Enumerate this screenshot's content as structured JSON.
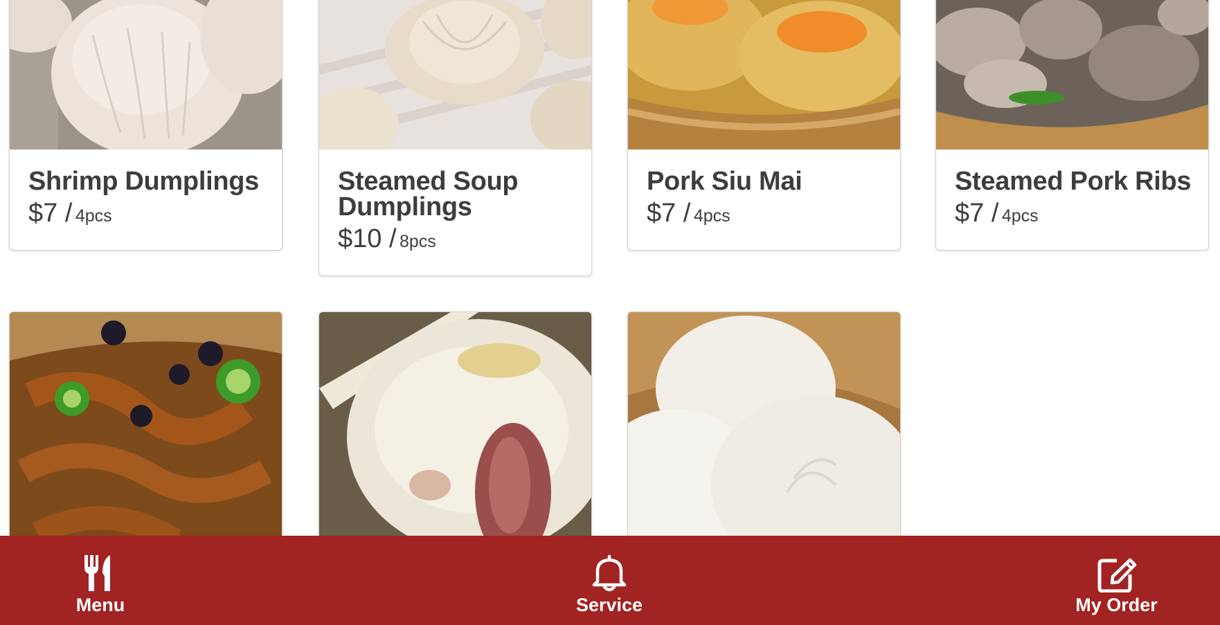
{
  "menu": {
    "items": [
      {
        "name": "Shrimp Dumplings",
        "price": "$7 /",
        "unit": "4pcs"
      },
      {
        "name": "Steamed Soup Dumplings",
        "price": "$10 /",
        "unit": "8pcs"
      },
      {
        "name": "Pork Siu Mai",
        "price": "$7 /",
        "unit": "4pcs"
      },
      {
        "name": "Steamed Pork Ribs",
        "price": "$7 /",
        "unit": "4pcs"
      }
    ]
  },
  "nav": {
    "menu_label": "Menu",
    "service_label": "Service",
    "order_label": "My Order"
  },
  "colors": {
    "nav_background": "#a12322",
    "text_dark": "#3d3d3d",
    "nav_text": "#ffffff"
  },
  "icons": {
    "menu": "fork-knife-icon",
    "service": "bell-icon",
    "order": "edit-icon"
  }
}
